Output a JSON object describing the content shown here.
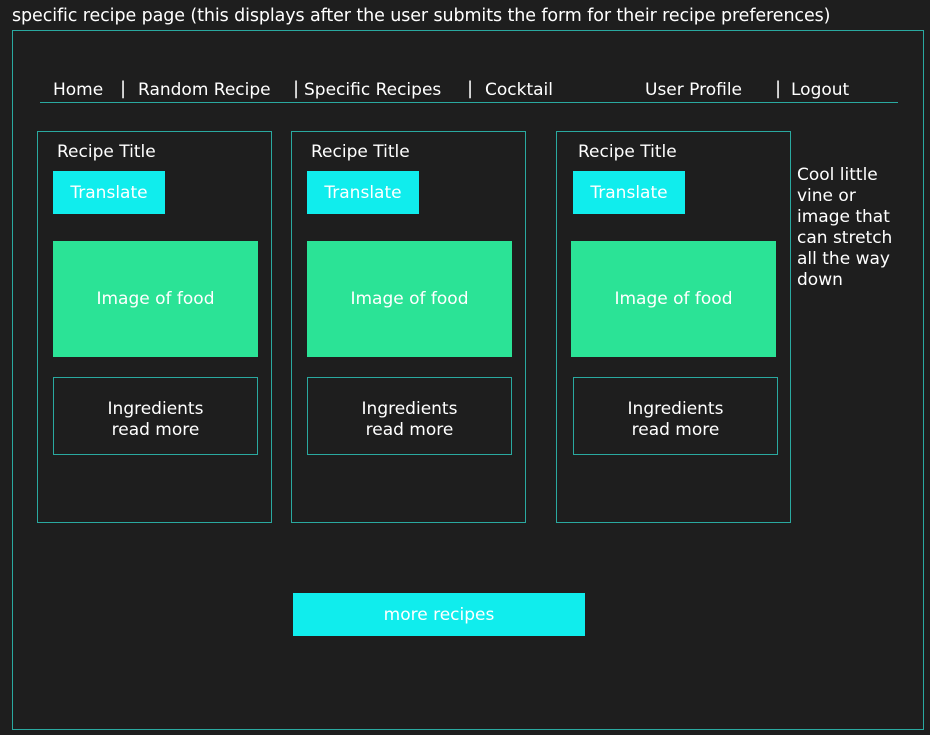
{
  "caption": "specific recipe page (this displays after the user submits the form for their recipe preferences)",
  "nav": {
    "home": "Home",
    "random": "Random Recipe",
    "specific": "Specific Recipes",
    "cocktail": "Cocktail",
    "profile": "User Profile",
    "logout": "Logout",
    "separator": "|"
  },
  "cards": [
    {
      "title": "Recipe Title",
      "translate": "Translate",
      "image": "Image of food",
      "ingredients": "Ingredients",
      "read_more": "read more"
    },
    {
      "title": "Recipe Title",
      "translate": "Translate",
      "image": "Image of food",
      "ingredients": "Ingredients",
      "read_more": "read more"
    },
    {
      "title": "Recipe Title",
      "translate": "Translate",
      "image": "Image of food",
      "ingredients": "Ingredients",
      "read_more": "read more"
    }
  ],
  "side_note": "Cool little vine or image that can stretch all the way down",
  "more_button": "more recipes",
  "colors": {
    "background": "#1e1e1e",
    "accent_cyan": "#10eded",
    "food_green": "#2be396",
    "border_teal": "#2aa9a0"
  }
}
